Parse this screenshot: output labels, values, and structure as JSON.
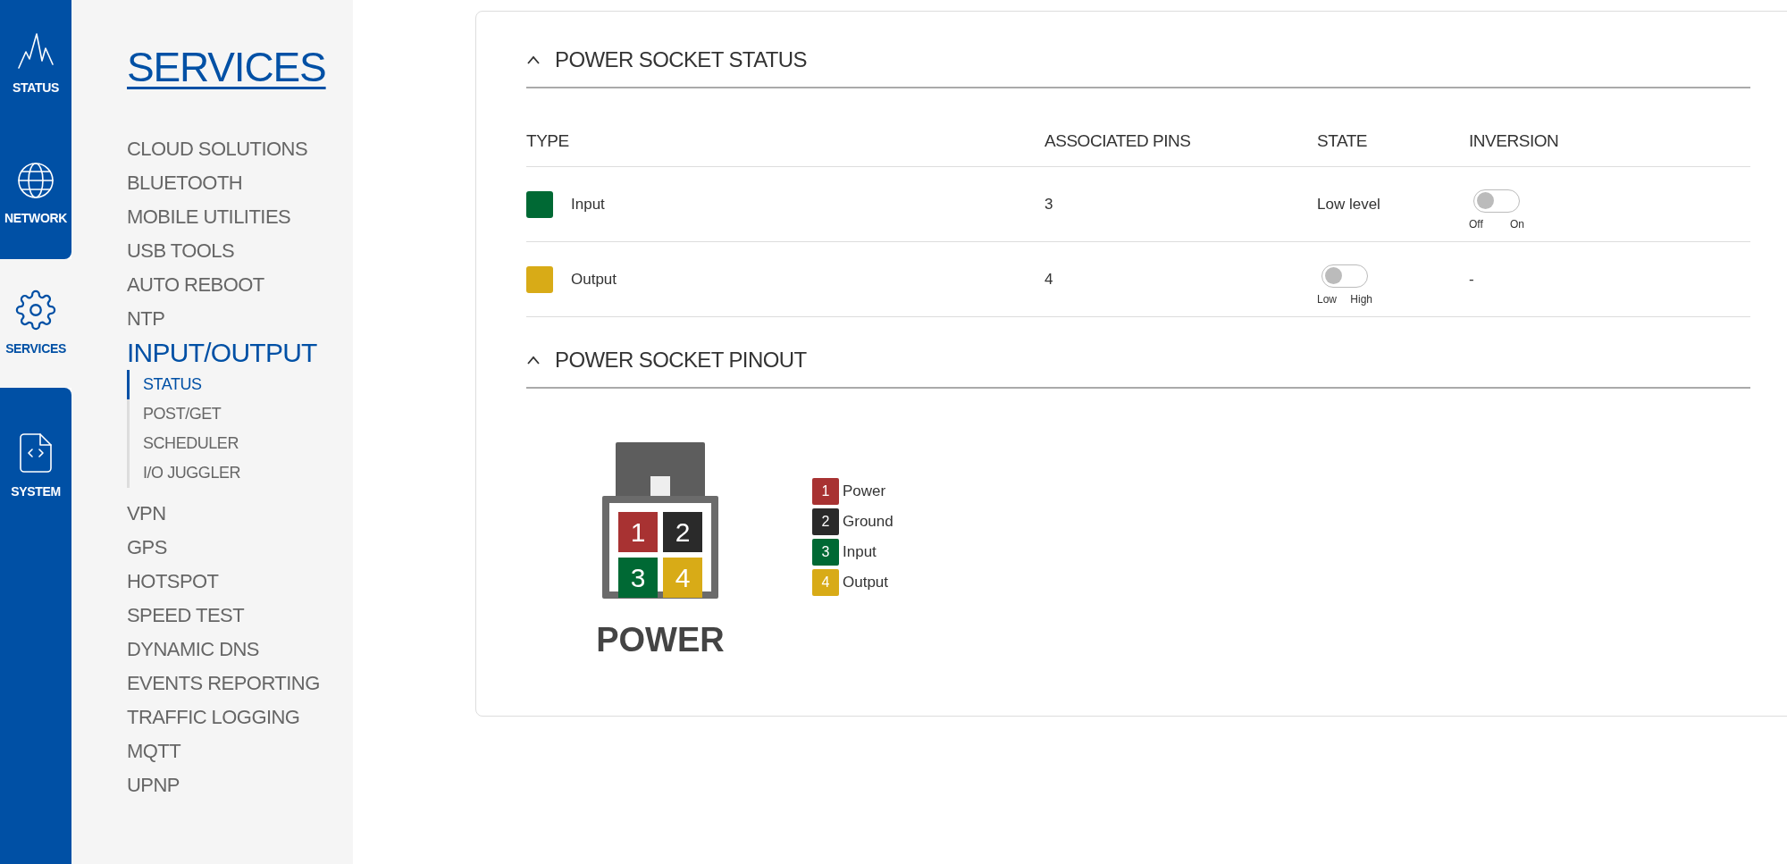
{
  "rail": [
    {
      "label": "STATUS",
      "selected": false
    },
    {
      "label": "NETWORK",
      "selected": false
    },
    {
      "label": "SERVICES",
      "selected": true
    },
    {
      "label": "SYSTEM",
      "selected": false
    }
  ],
  "sidebar": {
    "title": "SERVICES",
    "items": [
      {
        "label": "CLOUD SOLUTIONS",
        "selected": false
      },
      {
        "label": "BLUETOOTH",
        "selected": false
      },
      {
        "label": "MOBILE UTILITIES",
        "selected": false
      },
      {
        "label": "USB TOOLS",
        "selected": false
      },
      {
        "label": "AUTO REBOOT",
        "selected": false
      },
      {
        "label": "NTP",
        "selected": false
      },
      {
        "label": "INPUT/OUTPUT",
        "selected": true,
        "children": [
          {
            "label": "STATUS",
            "selected": true
          },
          {
            "label": "POST/GET",
            "selected": false
          },
          {
            "label": "SCHEDULER",
            "selected": false
          },
          {
            "label": "I/O JUGGLER",
            "selected": false
          }
        ]
      },
      {
        "label": "VPN",
        "selected": false
      },
      {
        "label": "GPS",
        "selected": false
      },
      {
        "label": "HOTSPOT",
        "selected": false
      },
      {
        "label": "SPEED TEST",
        "selected": false
      },
      {
        "label": "DYNAMIC DNS",
        "selected": false
      },
      {
        "label": "EVENTS REPORTING",
        "selected": false
      },
      {
        "label": "TRAFFIC LOGGING",
        "selected": false
      },
      {
        "label": "MQTT",
        "selected": false
      },
      {
        "label": "UPNP",
        "selected": false
      }
    ]
  },
  "status_section": {
    "title": "POWER SOCKET STATUS",
    "expanded": true,
    "columns": [
      "TYPE",
      "ASSOCIATED PINS",
      "STATE",
      "INVERSION"
    ],
    "rows": [
      {
        "type": "Input",
        "color": "#006934",
        "pins": "3",
        "state": {
          "kind": "text",
          "text": "Low level"
        },
        "inversion": {
          "kind": "toggle",
          "on": false,
          "off_label": "Off",
          "on_label": "On"
        }
      },
      {
        "type": "Output",
        "color": "#d8ab17",
        "pins": "4",
        "state": {
          "kind": "toggle",
          "on": false,
          "off_label": "Low",
          "on_label": "High"
        },
        "inversion": {
          "kind": "text",
          "text": "-"
        }
      }
    ]
  },
  "pinout_section": {
    "title": "POWER SOCKET PINOUT",
    "expanded": true,
    "connector_label": "POWER",
    "connector_pins": [
      {
        "number": "1",
        "color": "#a83232"
      },
      {
        "number": "2",
        "color": "#2a2a2a"
      },
      {
        "number": "3",
        "color": "#006934"
      },
      {
        "number": "4",
        "color": "#d8ab17"
      }
    ],
    "pins": [
      {
        "number": "1",
        "label": "Power",
        "color": "#a83232"
      },
      {
        "number": "2",
        "label": "Ground",
        "color": "#2a2a2a"
      },
      {
        "number": "3",
        "label": "Input",
        "color": "#006934"
      },
      {
        "number": "4",
        "label": "Output",
        "color": "#d8ab17"
      }
    ]
  }
}
